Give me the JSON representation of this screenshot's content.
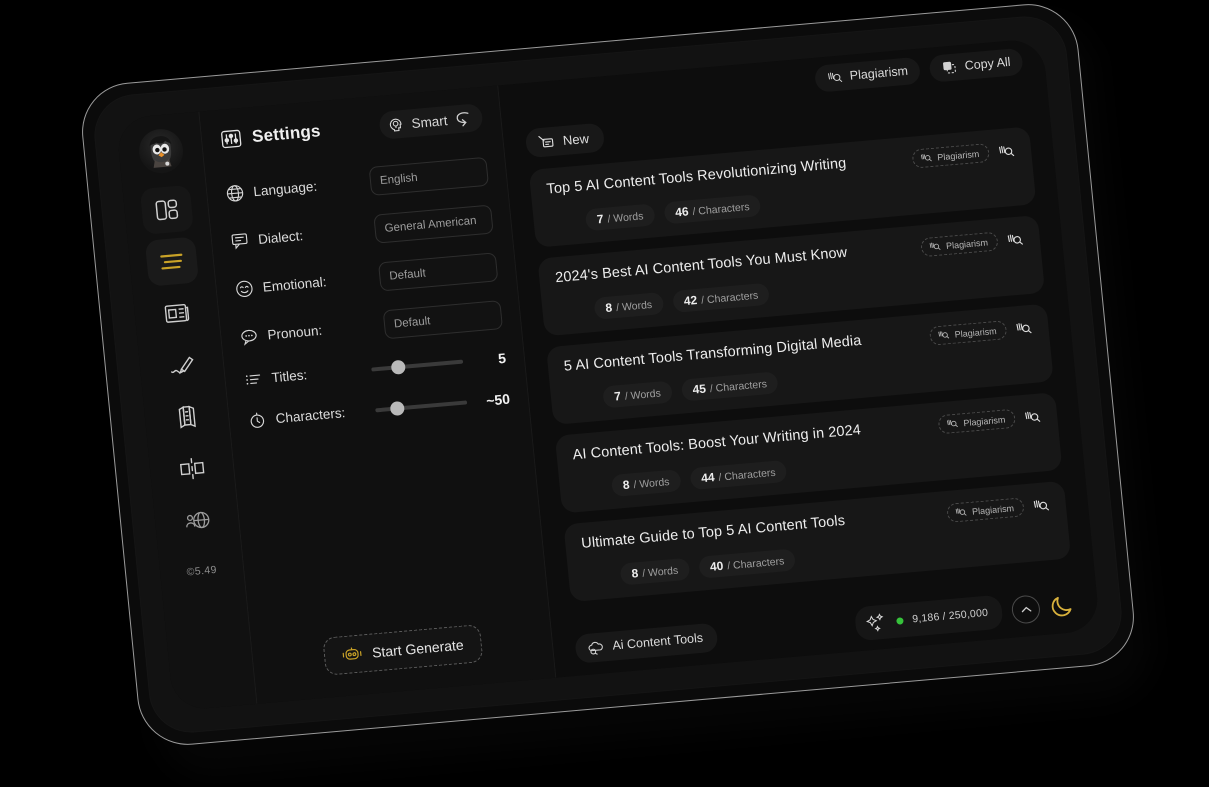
{
  "sidebar": {
    "avatar_alt": "user-avatar",
    "items": [
      {
        "name": "dashboard",
        "icon": "layout-grid-icon",
        "active": false
      },
      {
        "name": "lines",
        "icon": "lines-icon",
        "active": true
      },
      {
        "name": "articles",
        "icon": "newspaper-icon",
        "active": false
      },
      {
        "name": "write",
        "icon": "pencil-icon",
        "active": false
      },
      {
        "name": "layers",
        "icon": "layers-icon",
        "active": false
      },
      {
        "name": "compare",
        "icon": "split-compare-icon",
        "active": false
      },
      {
        "name": "translate",
        "icon": "globe-person-icon",
        "active": false
      }
    ],
    "version": "©5.49"
  },
  "settings": {
    "title": "Settings",
    "title_icon": "sliders-icon",
    "smart_label": "Smart",
    "smart_icon": "brain-head-icon",
    "smart_arrow_icon": "curved-arrow-icon",
    "fields": [
      {
        "label": "Language:",
        "value": "English",
        "icon": "globe-icon"
      },
      {
        "label": "Dialect:",
        "value": "General American",
        "icon": "speech-bubble-icon"
      },
      {
        "label": "Emotional:",
        "value": "Default",
        "icon": "smiley-icon"
      },
      {
        "label": "Pronoun:",
        "value": "Default",
        "icon": "chat-dots-icon"
      }
    ],
    "sliders": [
      {
        "label": "Titles:",
        "value": "5",
        "icon": "list-icon",
        "percent": 28
      },
      {
        "label": "Characters:",
        "value": "~50",
        "icon": "clock-icon",
        "percent": 22
      }
    ],
    "generate_label": "Start Generate",
    "generate_icon": "robot-icon"
  },
  "topbar": {
    "plagiarism_label": "Plagiarism",
    "plagiarism_icon": "plagiarism-icon",
    "copy_all_label": "Copy All",
    "copy_all_icon": "copy-icon"
  },
  "tabs": [
    {
      "label": "New",
      "icon": "new-doc-icon",
      "active": true
    }
  ],
  "cards": [
    {
      "title": "Top 5 AI Content Tools Revolutionizing Writing",
      "words": "7",
      "words_label": "/ Words",
      "chars": "46",
      "chars_label": "/ Characters",
      "plagiarism_label": "Plagiarism"
    },
    {
      "title": "2024's Best AI Content Tools You Must Know",
      "words": "8",
      "words_label": "/ Words",
      "chars": "42",
      "chars_label": "/ Characters",
      "plagiarism_label": "Plagiarism"
    },
    {
      "title": "5 AI Content Tools Transforming Digital Media",
      "words": "7",
      "words_label": "/ Words",
      "chars": "45",
      "chars_label": "/ Characters",
      "plagiarism_label": "Plagiarism"
    },
    {
      "title": "AI Content Tools: Boost Your Writing in 2024",
      "words": "8",
      "words_label": "/ Words",
      "chars": "44",
      "chars_label": "/ Characters",
      "plagiarism_label": "Plagiarism"
    },
    {
      "title": "Ultimate Guide to Top 5 AI Content Tools",
      "words": "8",
      "words_label": "/ Words",
      "chars": "40",
      "chars_label": "/ Characters",
      "plagiarism_label": "Plagiarism"
    }
  ],
  "bottombar": {
    "project_label": "Ai Content Tools",
    "project_icon": "cloud-tools-icon",
    "sparkle_icon": "sparkles-icon",
    "status_color": "#36c23b",
    "usage": "9,186 / 250,000",
    "collapse_icon": "chevron-up-icon",
    "theme_icon": "moon-icon"
  },
  "colors": {
    "accent_gold": "#c9a227",
    "status_green": "#36c23b",
    "moon_gold": "#d8b13c",
    "screen_bg": "#0e0e0e",
    "card_bg": "#171717"
  }
}
